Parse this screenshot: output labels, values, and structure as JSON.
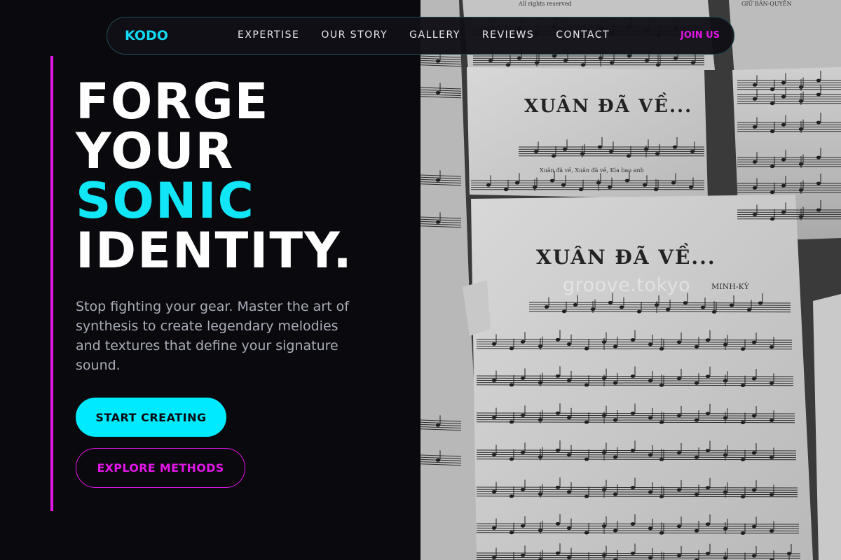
{
  "brand": {
    "logo": "KODO"
  },
  "nav": {
    "links": [
      "EXPERTISE",
      "OUR STORY",
      "GALLERY",
      "REVIEWS",
      "CONTACT"
    ],
    "join_label": "JOIN US"
  },
  "hero": {
    "headline": [
      "FORGE",
      "YOUR",
      "SONIC",
      "IDENTITY."
    ],
    "subtext": "Stop fighting your gear. Master the art of synthesis to create legendary melodies and textures that define your signature sound.",
    "primary_cta": "START CREATING",
    "secondary_cta": "EXPLORE METHODS"
  },
  "image": {
    "watermark": "groove.tokyo",
    "sheet_title": "XUÂN ĐÃ VỀ...",
    "sheet_composer": "MINH-KỲ",
    "copyright_top": "All rights reserved",
    "publisher_top": "GIỮ BẢN-QUYỀN",
    "lyric_line": "Xuân đã về, Xuân đã về, Kìa bao anh"
  },
  "colors": {
    "background": "#0a0a0e",
    "accent_cyan": "#00eaff",
    "accent_magenta": "#e316e8",
    "text_muted": "#a9adb8"
  }
}
